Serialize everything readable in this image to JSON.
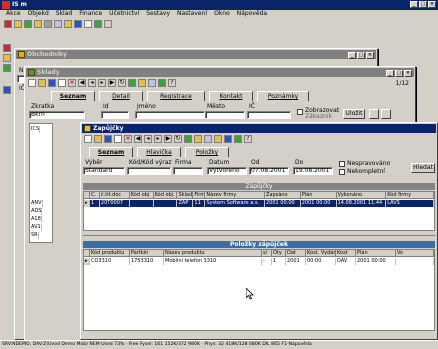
{
  "app": {
    "title": "IS m",
    "menu": [
      "Akce",
      "Objekd",
      "Sklad",
      "Finance",
      "Účetnictví",
      "Sestavy",
      "Nastavení",
      "Okno",
      "Nápověda"
    ]
  },
  "window_partners": {
    "title": "Obchodníky",
    "label_nazev": "Název",
    "label_ic": "IČ"
  },
  "window_sklady": {
    "title": "Sklady",
    "counter": "1/12",
    "tabs": [
      "Seznam",
      "Detail",
      "Registrace",
      "Kontakt",
      "Poznámky"
    ],
    "fields": {
      "label_zkratka": "Zkratka",
      "zkratka_value": "Bkrh",
      "label_id": "Id",
      "label_jmeno": "Jméno",
      "label_mesto": "Město",
      "label_ic": "IČ",
      "check_zobrazovat": "Zobrazovat",
      "check_zakaznik": "Zákazník",
      "btn_ulozit": "Uložit"
    },
    "left_rows": [
      "ICS",
      "ANV",
      "ADS",
      "A18",
      "AV1",
      "SR"
    ]
  },
  "window_zapujcky": {
    "title": "Zapůjčky",
    "tabs": [
      "Seznam",
      "Hlavička",
      "Položky"
    ],
    "labels": {
      "vyber": "Výběr",
      "kod_vyraz": "Kód/Kód výraz",
      "firma": "Firma",
      "datum": "Datum",
      "od": "Od",
      "do": "Do",
      "nespravovano": "Nespravováno",
      "nekompletni": "Nekompletní",
      "hledat": "Hledat"
    },
    "values": {
      "vyber": "Standard",
      "datum": "Vytvořeno",
      "od": "07.08.2001",
      "do": "19.08.2001"
    },
    "main_caption": "Zápůjčky",
    "main_columns": [
      "C.",
      "č.tit.doc",
      "Kód obj",
      "Kód obj.",
      "Sklad",
      "Firm.",
      "Název firmy",
      "Zapsáno",
      "Plán",
      "Vykonáno",
      "Kód firmy"
    ],
    "main_rows": [
      [
        "1",
        "20T0007",
        "",
        "",
        "ZAP",
        "11",
        "System Software a.s.",
        "2001 00:00",
        "2001 00:00",
        "14.08.2001 11:44",
        "LAVS"
      ]
    ],
    "items_caption": "Položky zápůjček",
    "items_columns": [
      "Kód produktu",
      "Partkin",
      "Název produktu",
      "s/",
      "Oty",
      "Dat",
      "Kost. Vydáno",
      "Kost",
      "Plán",
      "Vo"
    ],
    "items_rows": [
      [
        "CO3310",
        "1753310",
        "Mobilní telefon 3310",
        "-",
        "1",
        "2001",
        "00:00",
        "DAV",
        "2001 00:00",
        ""
      ]
    ]
  },
  "status_text": "SRV:NDEMO, DAV:Z(Úvod Demo Mob) NEM Used 73% · Free Fysel: 161 152K/372 980K · Phys: 32 418K/128 080K  DIL 865  F1-Nápověda"
}
